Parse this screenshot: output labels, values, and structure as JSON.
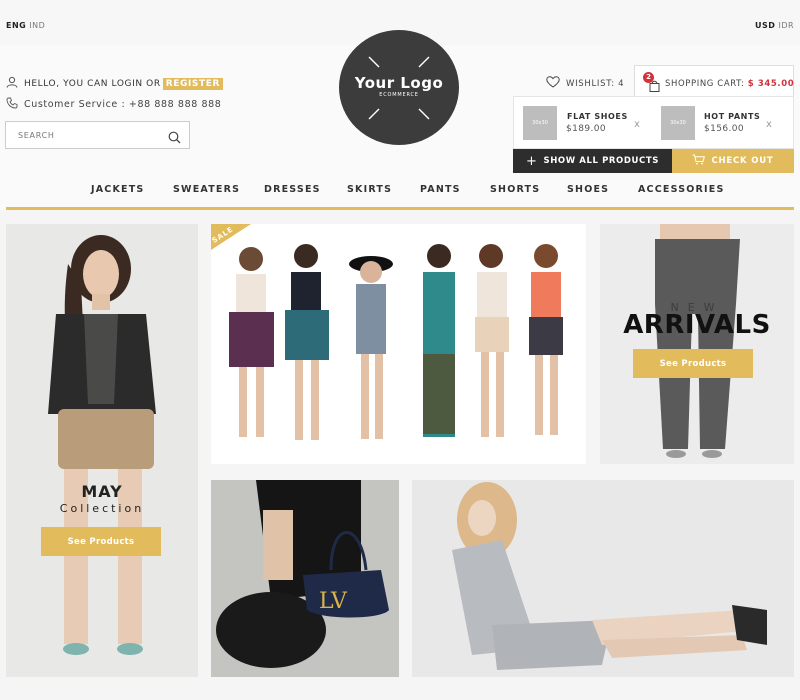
{
  "topbar": {
    "lang_active": "ENG",
    "lang_alt": "IND",
    "currency_active": "USD",
    "currency_alt": "IDR"
  },
  "account": {
    "login_text": "HELLO, YOU CAN LOGIN OR",
    "register_label": "REGISTER",
    "service_text": "Customer Service : +88 888 888 888"
  },
  "search": {
    "placeholder": "SEARCH"
  },
  "logo": {
    "main": "Your Logo",
    "sub": "ECOMMERCE"
  },
  "wishlist": {
    "label": "WISHLIST: 4"
  },
  "cart": {
    "count": "2",
    "label": "SHOPPING CART:",
    "total": "$ 345.00",
    "items": [
      {
        "name": "FLAT SHOES",
        "price": "$189.00",
        "thumb": "30x30",
        "remove": "x"
      },
      {
        "name": "HOT PANTS",
        "price": "$156.00",
        "thumb": "30x30",
        "remove": "x"
      }
    ],
    "show_all_label": "SHOW ALL PRODUCTS",
    "checkout_label": "CHECK OUT"
  },
  "nav": [
    "JACKETS",
    "SWEATERS",
    "DRESSES",
    "SKIRTS",
    "PANTS",
    "SHORTS",
    "SHOES",
    "ACCESSORIES"
  ],
  "promos": {
    "may": {
      "title": "MAY",
      "subtitle": "Collection",
      "cta": "See Products"
    },
    "sale": {
      "ribbon": "SALE"
    },
    "arrivals": {
      "small": "NEW",
      "title": "ARRIVALS",
      "cta": "See Products"
    }
  },
  "colors": {
    "accent": "#e2bc5c",
    "dark": "#2d2d2d",
    "price_red": "#d2323c",
    "logo_bg": "#3c3c3c"
  }
}
